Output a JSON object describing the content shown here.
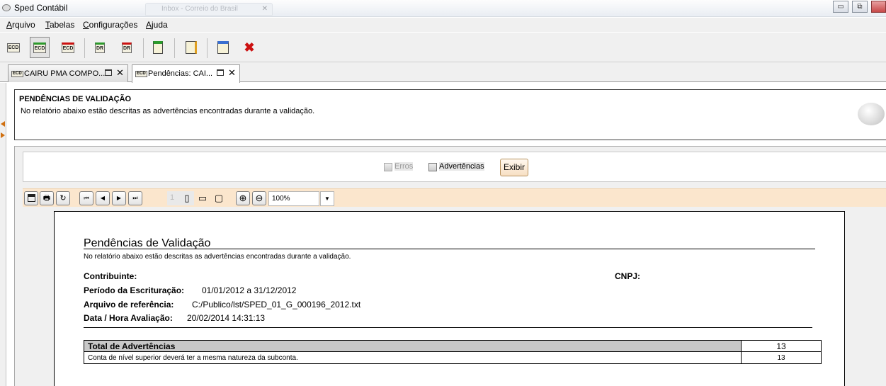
{
  "window": {
    "title": "Sped Contábil",
    "background_tab": "Inbox - Correio do Brasil",
    "controls": {
      "minimize": "▭",
      "restore": "⧉"
    }
  },
  "menu": [
    "Arquivo",
    "Tabelas",
    "Configurações",
    "Ajuda"
  ],
  "toolbar": {
    "icons": [
      "ecd-icon",
      "ecd-import-icon",
      "ecd-delete-icon",
      "dr-import-icon",
      "dr-delete-icon",
      "validate-icon",
      "edit-icon",
      "help-icon",
      "close-icon"
    ],
    "ecd_text": "ECD",
    "dr_text": "DR",
    "close_glyph": "✖",
    "accent_red": "#cc1111"
  },
  "tabs": [
    {
      "label": "CAIRU PMA COMPO...",
      "icon_text": "ECD",
      "selected": false
    },
    {
      "label": "Pendências: CAI...",
      "icon_text": "ECD",
      "selected": true
    }
  ],
  "tab_close_glyph": "✕",
  "info_panel": {
    "title": "PENDÊNCIAS DE VALIDAÇÃO",
    "description": "No relatório abaixo estão descritas as advertências encontradas durante a validação."
  },
  "filters": {
    "erros_label": "Erros",
    "erros_checked": false,
    "erros_enabled": false,
    "advertencias_label": "Advertências",
    "advertencias_checked": false,
    "exibir_label": "Exibir"
  },
  "viewer": {
    "buttons": {
      "save": "💾",
      "print": "🖶",
      "refresh": "↻",
      "first": "⏮",
      "prev": "◀",
      "next": "▶",
      "last": "⏭",
      "page_single": "▯",
      "page_width": "▭",
      "page_full": "▢",
      "zoom_in": "⊕",
      "zoom_out": "⊖",
      "zoom_arrow": "▼"
    },
    "page_number": "1",
    "zoom": "100%",
    "toolbar_color": "#fbe6cd"
  },
  "report": {
    "title": "Pendências de Validação",
    "description": "No relatório abaixo estão descritas as advertências encontradas durante a validação.",
    "contribuinte_label": "Contribuinte:",
    "contribuinte_value": "",
    "cnpj_label": "CNPJ:",
    "cnpj_value": "",
    "periodo_label": "Período da Escrituração:",
    "periodo_value": "01/01/2012 a 31/12/2012",
    "arquivo_label": "Arquivo de referência:",
    "arquivo_value": "C:/Publico/lst/SPED_01_G_000196_2012.txt",
    "data_label": "Data / Hora Avaliação:",
    "data_value": "20/02/2014 14:31:13",
    "table": {
      "header": {
        "label": "Total de Advertências",
        "count": "13"
      },
      "rows": [
        {
          "label": "Conta de nível superior deverá ter a mesma natureza da subconta.",
          "count": "13"
        }
      ]
    }
  }
}
